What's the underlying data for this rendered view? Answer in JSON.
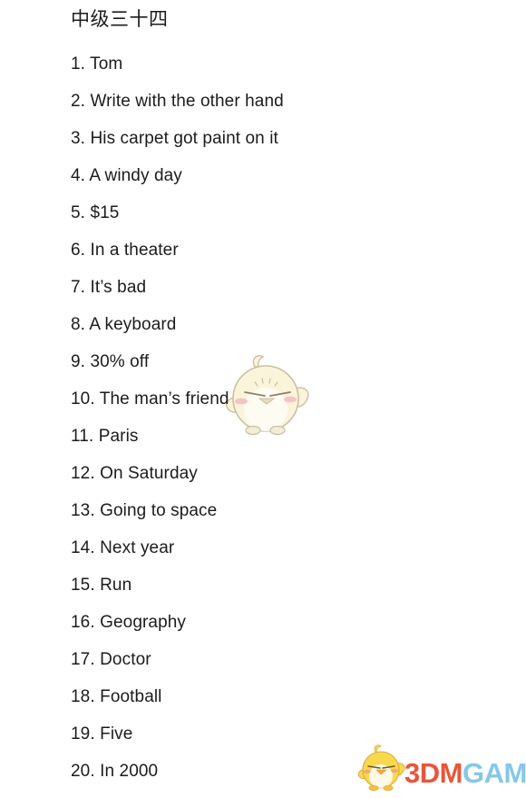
{
  "page": {
    "background_color": "#ffffff",
    "text_color": "#1c1c1c",
    "title": "中级三十四"
  },
  "answers": [
    {
      "index": "1.",
      "text": "Tom"
    },
    {
      "index": "2.",
      "text": "Write with the other hand"
    },
    {
      "index": "3.",
      "text": "His carpet got paint on it"
    },
    {
      "index": "4.",
      "text": "A windy day"
    },
    {
      "index": "5.",
      "text": "$15"
    },
    {
      "index": "6.",
      "text": "In a theater"
    },
    {
      "index": "7.",
      "text": "It’s bad"
    },
    {
      "index": "8.",
      "text": "A keyboard"
    },
    {
      "index": "9.",
      "text": "30% off"
    },
    {
      "index": "10.",
      "text": "The man’s friend"
    },
    {
      "index": "11.",
      "text": "Paris"
    },
    {
      "index": "12.",
      "text": "On Saturday"
    },
    {
      "index": "13.",
      "text": "Going to space"
    },
    {
      "index": "14.",
      "text": "Next year"
    },
    {
      "index": "15.",
      "text": "Run"
    },
    {
      "index": "16.",
      "text": "Geography"
    },
    {
      "index": "17.",
      "text": "Doctor"
    },
    {
      "index": "18.",
      "text": "Football"
    },
    {
      "index": "19.",
      "text": "Five"
    },
    {
      "index": "20.",
      "text": "In 2000"
    }
  ],
  "watermark": {
    "icon": "chick-watermark-icon",
    "body_color": "#faf4db",
    "outline_color": "#cbbfa2",
    "belly_color": "#fdfbf2",
    "cheek_color": "#f0bcc0"
  },
  "logo": {
    "mascot_icon": "chick-mascot-icon",
    "mascot_body_color": "#f7d94e",
    "mascot_outline_color": "#e0a93c",
    "mascot_belly_color": "#fdf8e8",
    "text_primary": "3DM",
    "text_secondary": "GAME",
    "trademark": "®",
    "primary_color": "#e8563a",
    "secondary_color": "#84c8e8"
  }
}
